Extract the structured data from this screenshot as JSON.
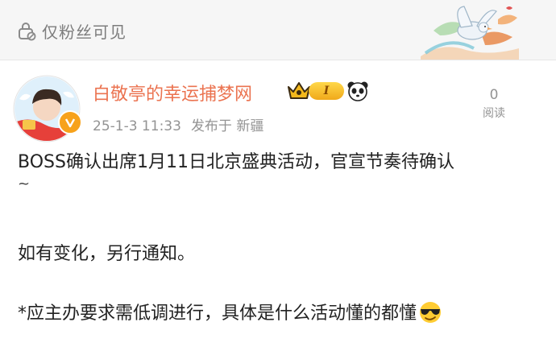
{
  "header": {
    "privacy_label": "仅粉丝可见",
    "privacy_icon": "lock-icon",
    "decoration_icon": "dove-decoration-icon"
  },
  "post": {
    "author": {
      "name": "白敬亭的幸运捕梦网",
      "verified_badge_icon": "verified-badge-icon",
      "member_icon": "member-crown-icon",
      "level_label": "I",
      "extra_badge_icon": "panda-icon"
    },
    "timestamp": "25-1-3 11:33",
    "location": "发布于 新疆",
    "reads": {
      "count": "0",
      "label": "阅读"
    },
    "text": {
      "line1": "BOSS确认出席1月11日北京盛典活动，官宣节奏待确认",
      "line1_cont": "~",
      "paragraph2": "如有变化，另行通知。",
      "paragraph3": "*应主办要求需低调进行，具体是什么活动懂的都懂",
      "emoji_icon": "sunglasses-emoji-icon"
    }
  },
  "colors": {
    "username": "#eb7350",
    "meta": "#939393",
    "text": "#222222",
    "topbar_bg": "#f6f6f6"
  }
}
